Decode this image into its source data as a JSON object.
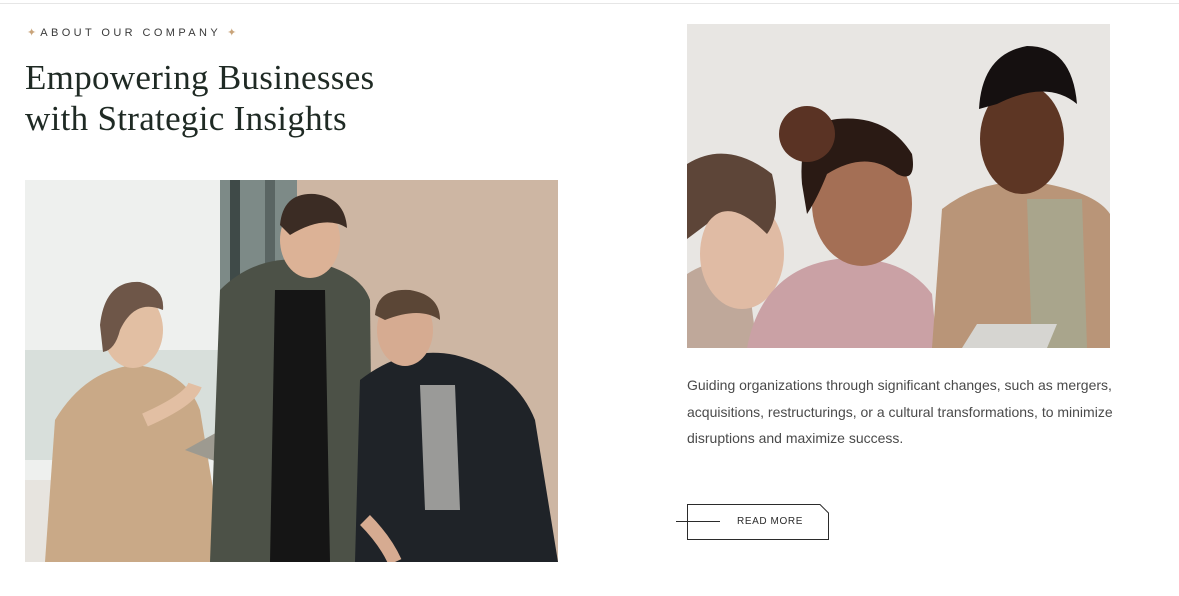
{
  "about": {
    "eyebrow": "ABOUT OUR COMPANY",
    "sparkle_icon": "sparkle-icon",
    "heading_line1": "Empowering Businesses",
    "heading_line2": "with Strategic Insights"
  },
  "images": {
    "left_photo": "team-meeting-photo",
    "right_photo": "team-laughing-photo"
  },
  "content": {
    "description": "Guiding organizations through significant changes, such as mergers, acquisitions, restructurings, or a cultural transformations, to minimize disruptions and maximize success.",
    "cta_label": "READ MORE"
  },
  "colors": {
    "heading": "#1f2a24",
    "accent": "#c9a47a",
    "text": "#4a4a4a",
    "background": "#ffffff"
  }
}
